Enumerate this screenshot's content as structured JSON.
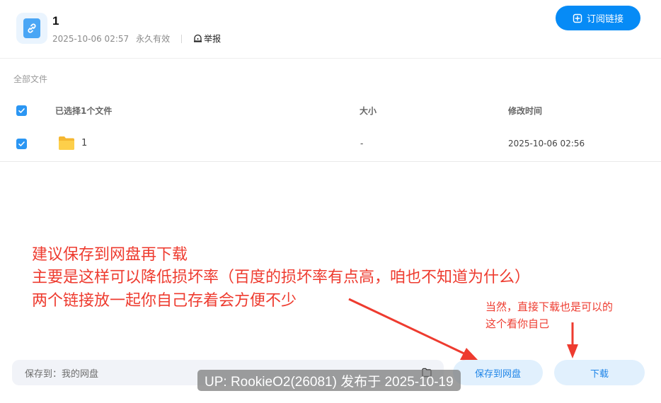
{
  "header": {
    "title": "1",
    "date": "2025-10-06 02:57",
    "validity": "永久有效",
    "report_label": "举报",
    "subscribe_label": "订阅链接"
  },
  "breadcrumb": "全部文件",
  "table": {
    "selected_label": "已选择1个文件",
    "size_header": "大小",
    "modified_header": "修改时间",
    "rows": [
      {
        "name": "1",
        "size": "-",
        "modified": "2025-10-06 02:56"
      }
    ]
  },
  "annotations": {
    "line1": "建议保存到网盘再下载",
    "line2": "主要是这样可以降低损坏率（百度的损坏率有点高，咱也不知道为什么）",
    "line3": "两个链接放一起你自己存着会方便不少",
    "small1": "当然，直接下载也是可以的",
    "small2": "这个看你自己"
  },
  "footer": {
    "save_to_label": "保存到：我的网盘",
    "save_button": "保存到网盘",
    "download_button": "下载"
  },
  "watermark": "UP: RookieO2(26081) 发布于 2025-10-19",
  "colors": {
    "accent": "#068bf6",
    "annotation": "#ee3b2f",
    "button_light": "#e1f0fd",
    "checkbox": "#2b96f3"
  },
  "icons": [
    "link-icon",
    "report-icon",
    "subscribe-plus-icon",
    "folder-icon",
    "checkbox-checked-icon",
    "folder-picker-icon",
    "arrow-icon"
  ]
}
